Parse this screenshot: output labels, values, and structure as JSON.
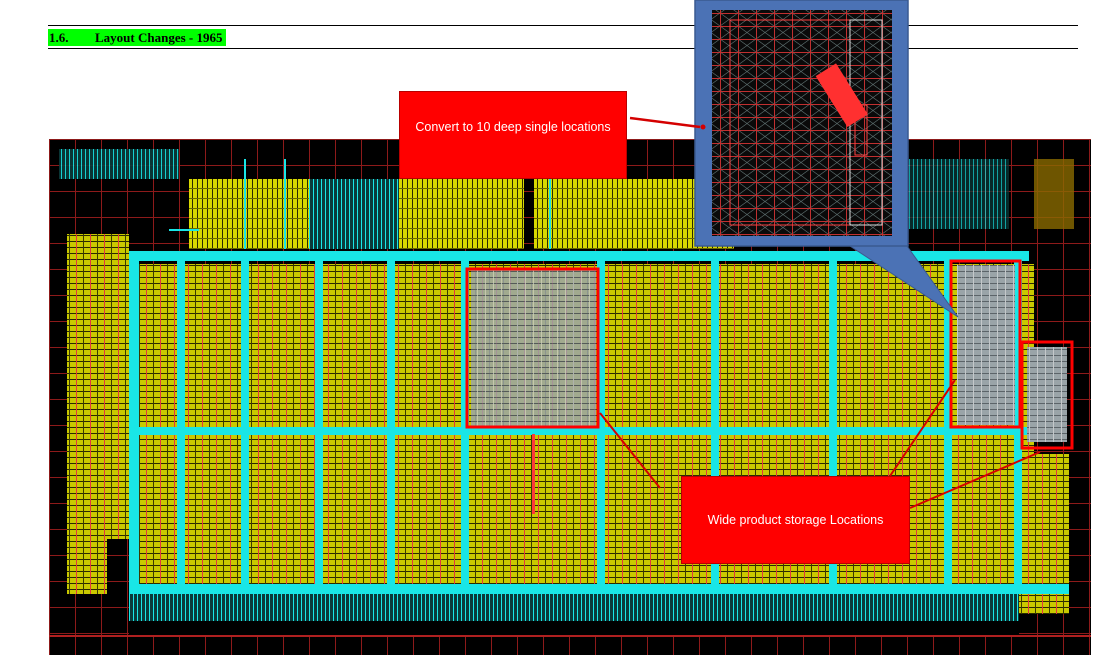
{
  "heading": {
    "number": "1.6.",
    "title": "Layout Changes - 1965"
  },
  "callouts": {
    "convert": "Convert to 10 deep single locations",
    "wide": "Wide product storage Locations"
  },
  "colors": {
    "highlight": "#00ff00",
    "background": "#000000",
    "aisle": "#19e6e6",
    "rack": "#d8d800",
    "callout": "#ff0000",
    "zoom_border": "#4b72b5"
  }
}
